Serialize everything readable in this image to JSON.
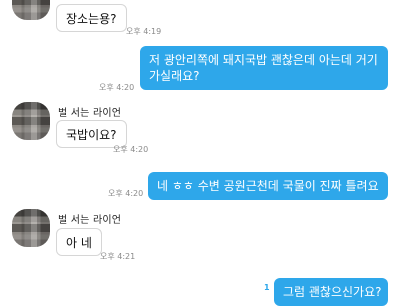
{
  "messages": [
    {
      "text": "장소는용?",
      "time": "오후 4:19"
    },
    {
      "text": "저 광안리쪽에 돼지국밥 괜찮은데 아는데 거기 가실래요?",
      "time": "오후 4:20"
    },
    {
      "sender": "벌 서는 라이언",
      "text": "국밥이요?",
      "time": "오후 4:20"
    },
    {
      "text": "네 ㅎㅎ 수변 공원근천데 국물이 진짜 틀려요",
      "time": "오후 4:20"
    },
    {
      "sender": "벌 서는 라이언",
      "text": "아 네",
      "time": "오후 4:21"
    },
    {
      "text": "그럼 괜찮으신가요?",
      "unread": "1"
    }
  ]
}
